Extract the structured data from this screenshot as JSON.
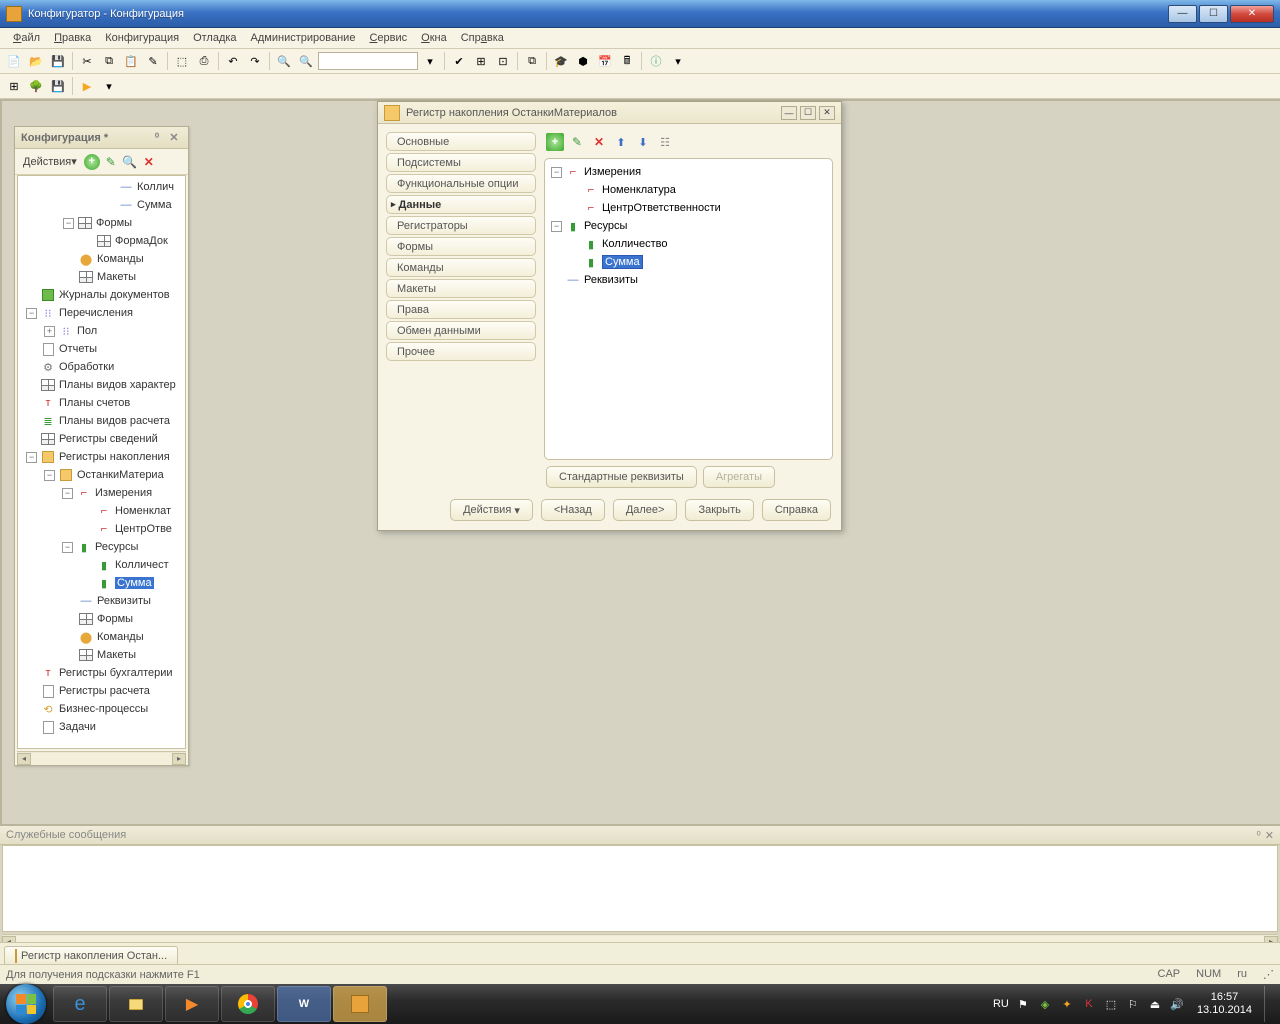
{
  "win_title": "Конфигуратор - Конфигурация",
  "menubar": [
    "Файл",
    "Правка",
    "Конфигурация",
    "Отладка",
    "Администрирование",
    "Сервис",
    "Окна",
    "Справка"
  ],
  "config_panel": {
    "title": "Конфигурация *",
    "actions_label": "Действия"
  },
  "tree": {
    "n0": "Коллич",
    "n1": "Сумма",
    "forms": "Формы",
    "formadoc": "ФормаДок",
    "cmds": "Команды",
    "layouts": "Макеты",
    "journals": "Журналы документов",
    "enums": "Перечисления",
    "pol": "Пол",
    "reports": "Отчеты",
    "proc": "Обработки",
    "pkh": "Планы видов характер",
    "ps": "Планы счетов",
    "pvr": "Планы видов расчета",
    "rsved": "Регистры сведений",
    "raccum": "Регистры накопления",
    "ostmat": "ОстанкиМатериа",
    "izm": "Измерения",
    "nomen": "Номенклат",
    "centr": "ЦентрОтве",
    "res": "Ресурсы",
    "koll": "Колличест",
    "summa": "Сумма",
    "rekv": "Реквизиты",
    "forms2": "Формы",
    "cmds2": "Команды",
    "layouts2": "Макеты",
    "rbuh": "Регистры бухгалтерии",
    "rrasch": "Регистры расчета",
    "bp": "Бизнес-процессы",
    "tasks": "Задачи"
  },
  "modal": {
    "title": "Регистр накопления ОстанкиМатериалов",
    "nav": [
      "Основные",
      "Подсистемы",
      "Функциональные опции",
      "Данные",
      "Регистраторы",
      "Формы",
      "Команды",
      "Макеты",
      "Права",
      "Обмен данными",
      "Прочее"
    ],
    "tree": {
      "izm": "Измерения",
      "nomen": "Номенклатура",
      "centr": "ЦентрОтветственности",
      "res": "Ресурсы",
      "koll": "Колличество",
      "summa": "Сумма",
      "rekv": "Реквизиты"
    },
    "btn_std": "Стандартные реквизиты",
    "btn_agg": "Агрегаты",
    "ftr_actions": "Действия",
    "ftr_back": "<Назад",
    "ftr_next": "Далее>",
    "ftr_close": "Закрыть",
    "ftr_help": "Справка"
  },
  "messages_title": "Служебные сообщения",
  "dock_tab": "Регистр накопления Остан...",
  "status_hint": "Для получения подсказки нажмите F1",
  "status_cells": {
    "cap": "CAP",
    "num": "NUM",
    "lang": "ru"
  },
  "tray": {
    "lang": "RU",
    "time": "16:57",
    "date": "13.10.2014"
  }
}
